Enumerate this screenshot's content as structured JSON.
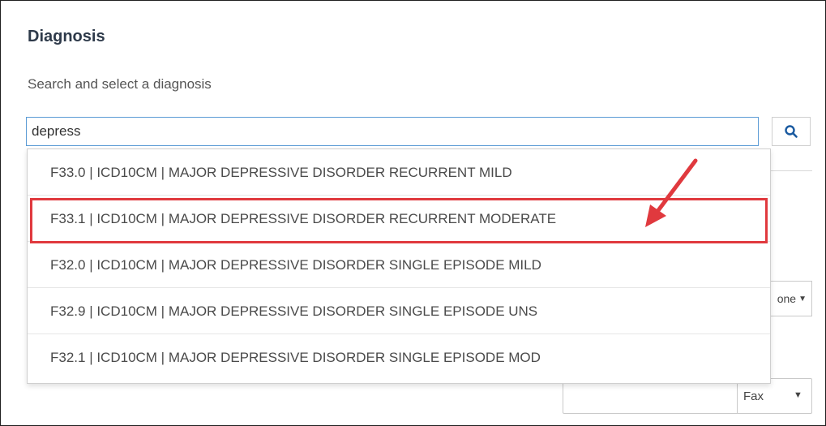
{
  "section": {
    "title": "Diagnosis",
    "label": "Search and select a diagnosis"
  },
  "search": {
    "value": "depress",
    "button_icon": "search-icon"
  },
  "options": [
    {
      "text": "F33.0 | ICD10CM | MAJOR DEPRESSIVE DISORDER RECURRENT MILD"
    },
    {
      "text": "F33.1 | ICD10CM | MAJOR DEPRESSIVE DISORDER RECURRENT MODERATE"
    },
    {
      "text": "F32.0 | ICD10CM | MAJOR DEPRESSIVE DISORDER SINGLE EPISODE MILD"
    },
    {
      "text": "F32.9 | ICD10CM | MAJOR DEPRESSIVE DISORDER SINGLE EPISODE UNS"
    },
    {
      "text": "F32.1 | ICD10CM | MAJOR DEPRESSIVE DISORDER SINGLE EPISODE MOD"
    }
  ],
  "background": {
    "select1_text": "one",
    "select2_text": "Fax"
  },
  "colors": {
    "accent": "#5b9bd5",
    "annotation": "#e0393e",
    "icon": "#1a5aa0"
  }
}
